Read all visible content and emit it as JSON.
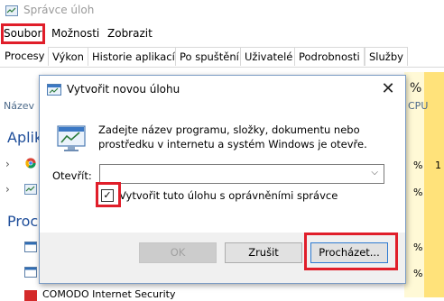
{
  "task_manager": {
    "title": "Správce úloh",
    "menu": [
      "Soubor",
      "Možnosti",
      "Zobrazit"
    ],
    "tabs": [
      "Procesy",
      "Výkon",
      "Historie aplikací",
      "Po spuštění",
      "Uživatelé",
      "Podrobnosti",
      "Služby"
    ],
    "column_name": "Název",
    "column_pct_head": "%",
    "column_pct_sub": "CPU",
    "group_apps": "Aplik",
    "group_processes": "Proce",
    "partial_row_text": "COMODO Internet Security",
    "pct_values": [
      "%",
      "%",
      "%",
      "%",
      "%"
    ],
    "pct2_value": "1"
  },
  "dialog": {
    "title": "Vytvořit novou úlohu",
    "description": "Zadejte název programu, složky, dokumentu nebo prostředku v internetu a systém Windows je otevře.",
    "open_label": "Otevřít:",
    "open_value": "",
    "admin_label": "Vytvořit tuto úlohu s oprávněními správce",
    "admin_checked": "✓",
    "ok_label": "OK",
    "cancel_label": "Zrušit",
    "browse_label": "Procházet...",
    "close_glyph": "✕"
  },
  "colors": {
    "highlight": "#e01e2a",
    "group_blue": "#1f4e9a",
    "cpu_strip": "#fff9d6",
    "cpu_strip_strong": "#ffe27a"
  },
  "icons": [
    "taskmanager-icon",
    "run-dialog-icon",
    "chrome-icon",
    "close-icon",
    "dropdown-arrow-icon",
    "check-icon"
  ]
}
